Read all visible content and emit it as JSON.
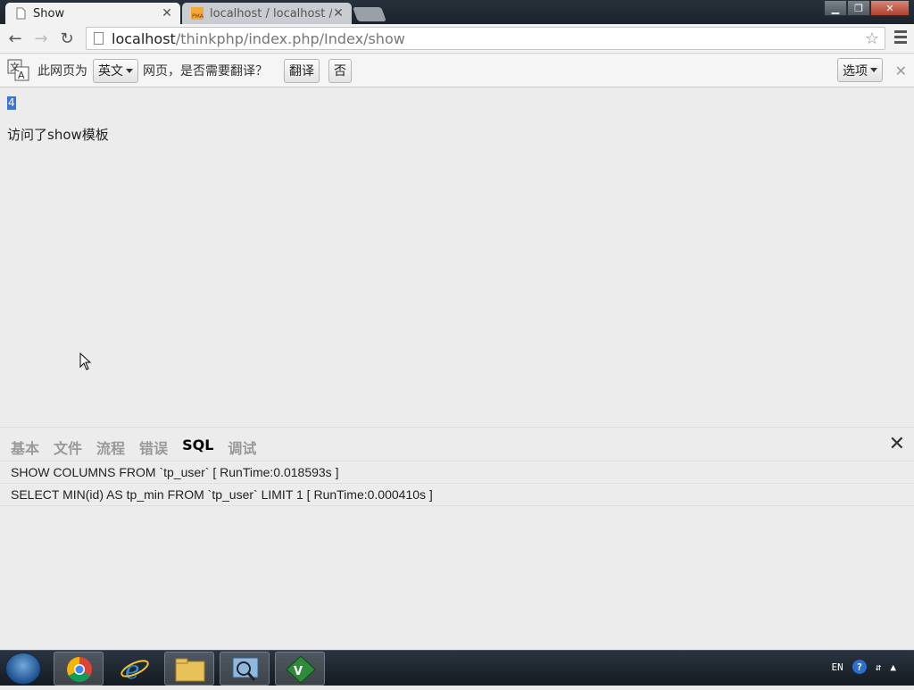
{
  "browser": {
    "tabs": [
      {
        "title": "Show",
        "active": true
      },
      {
        "title": "localhost / localhost / tl",
        "active": false
      }
    ],
    "url_host": "localhost",
    "url_path": "/thinkphp/index.php/Index/show"
  },
  "translate_bar": {
    "prefix": "此网页为",
    "language": "英文",
    "suffix": "网页，是否需要翻译？",
    "translate_label": "翻译",
    "no_label": "否",
    "options_label": "选项"
  },
  "page": {
    "number": "4",
    "message": "访问了show模板"
  },
  "trace": {
    "tabs": [
      "基本",
      "文件",
      "流程",
      "错误",
      "SQL",
      "调试"
    ],
    "active_tab": "SQL",
    "lines": [
      "SHOW COLUMNS FROM `tp_user` [ RunTime:0.018593s ]",
      "SELECT MIN(id) AS tp_min FROM `tp_user` LIMIT 1 [ RunTime:0.000410s ]"
    ]
  },
  "taskbar": {
    "apps": [
      "chrome-icon",
      "ie-icon",
      "explorer-icon",
      "magnifier-icon",
      "vim-icon"
    ],
    "lang": "EN"
  },
  "colors": {
    "selection": "#3875d7",
    "page_bg": "#ececec"
  }
}
